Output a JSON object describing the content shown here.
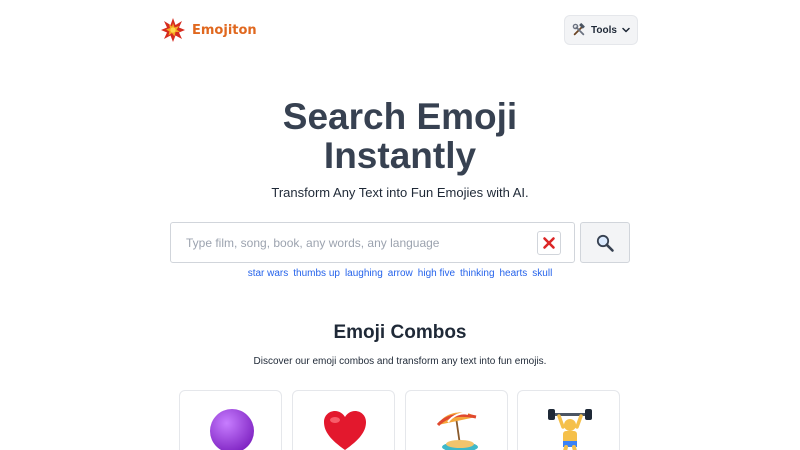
{
  "header": {
    "brand": "Emojiton",
    "tools_label": "Tools",
    "logo_icon": "explosion-logo-icon",
    "tools_icon": "hammer-wrench-icon"
  },
  "hero": {
    "title_line1": "Search Emoji",
    "title_line2": "Instantly",
    "subtitle": "Transform Any Text into Fun Emojies with AI."
  },
  "search": {
    "value": "",
    "placeholder": "Type film, song, book, any words, any language",
    "clear_icon": "red-x-icon",
    "search_icon": "magnifier-icon"
  },
  "suggestions": [
    "star wars",
    "thumbs up",
    "laughing",
    "arrow",
    "high five",
    "thinking",
    "hearts",
    "skull"
  ],
  "combos": {
    "title": "Emoji Combos",
    "subtitle": "Discover our emoji combos and transform any text into fun emojis.",
    "cards": [
      {
        "icon": "purple-circle-icon"
      },
      {
        "icon": "red-heart-icon"
      },
      {
        "icon": "beach-umbrella-icon"
      },
      {
        "icon": "weight-lifter-icon"
      }
    ]
  },
  "colors": {
    "brand": "#e0681f",
    "title": "#374151",
    "link": "#2563eb",
    "clear_red": "#dc2626"
  }
}
